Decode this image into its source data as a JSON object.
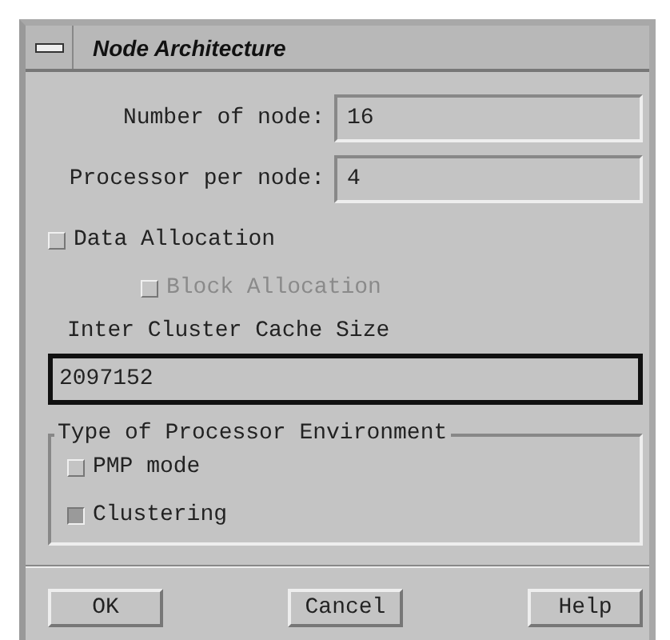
{
  "window": {
    "title": "Node Architecture"
  },
  "fields": [
    {
      "label": "Number of node:",
      "value": "16"
    },
    {
      "label": "Processor per node:",
      "value": "4"
    }
  ],
  "allocation": [
    {
      "label": "Data Allocation",
      "checked": false,
      "disabled": false,
      "children": [
        {
          "label": "Block Allocation",
          "checked": false,
          "disabled": true
        }
      ]
    }
  ],
  "cache": {
    "label": "Inter Cluster Cache Size",
    "value": "2097152",
    "focused": true
  },
  "environment": {
    "title": "Type of Processor Environment",
    "options": [
      {
        "label": "PMP mode",
        "checked": false
      },
      {
        "label": "Clustering",
        "checked": true
      }
    ]
  },
  "buttons": [
    "OK",
    "Cancel",
    "Help"
  ]
}
